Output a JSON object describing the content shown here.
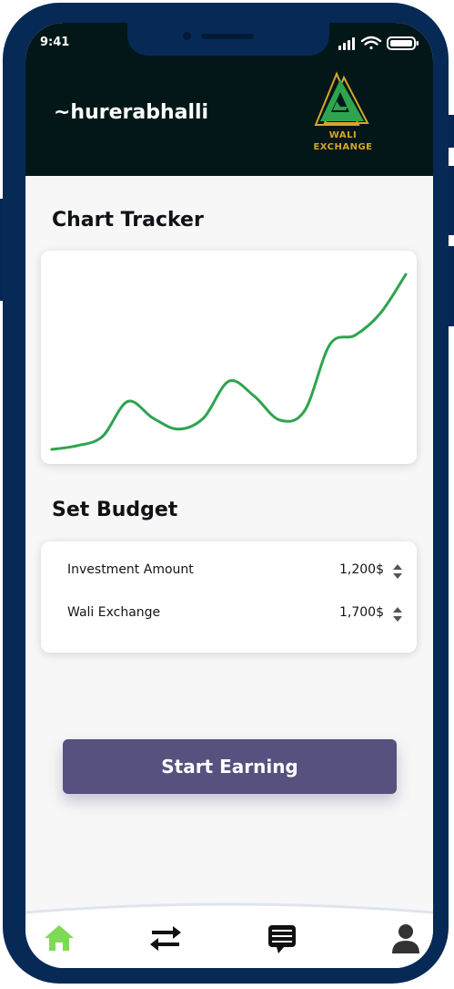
{
  "status_bar": {
    "time": "9:41"
  },
  "header": {
    "username": "~hurerabhalli",
    "logo_line1": "WALI",
    "logo_line2": "EXCHANGE"
  },
  "chart_section": {
    "title": "Chart Tracker"
  },
  "chart_data": {
    "type": "line",
    "x": [
      0,
      1,
      2,
      3,
      4,
      5,
      6,
      7,
      8,
      9,
      10,
      11,
      12,
      13,
      14
    ],
    "y": [
      1,
      3,
      8,
      27,
      18,
      12,
      18,
      38,
      30,
      17,
      22,
      58,
      63,
      75,
      96
    ],
    "ylim": [
      0,
      100
    ],
    "color": "#2ea44f",
    "grid": false
  },
  "budget_section": {
    "title": "Set Budget",
    "rows": [
      {
        "label": "Investment Amount",
        "value": "1,200$"
      },
      {
        "label": "Wali Exchange",
        "value": "1,700$"
      }
    ]
  },
  "cta": {
    "label": "Start Earning"
  },
  "nav": {
    "items": [
      "home-icon",
      "transfer-icon",
      "chat-icon",
      "profile-icon"
    ],
    "active": "home-icon",
    "active_color": "#7ed957"
  },
  "colors": {
    "header_bg": "#031719",
    "frame": "#062956",
    "button": "#575180",
    "accent_gold": "#d6a629",
    "logo_green": "#2ea44f"
  }
}
